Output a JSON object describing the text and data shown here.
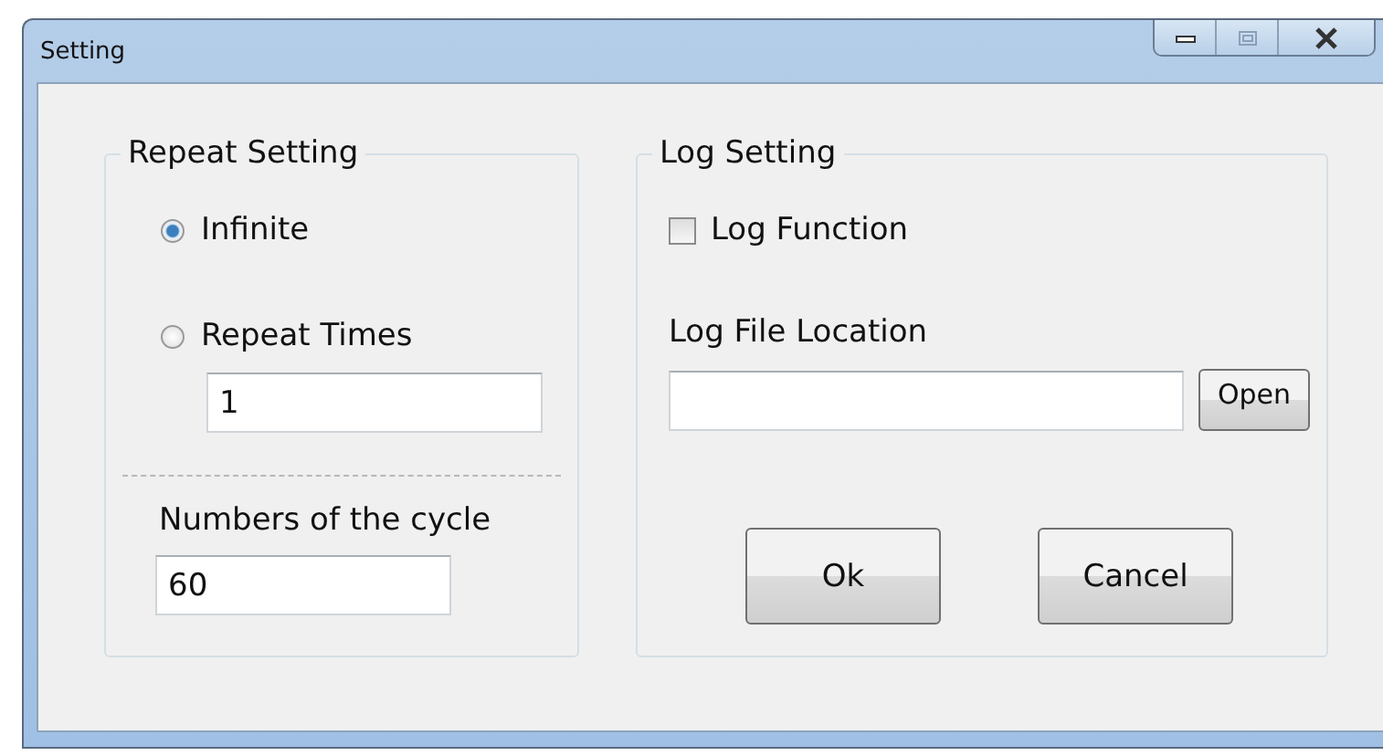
{
  "window": {
    "title": "Setting"
  },
  "repeat_setting": {
    "title": "Repeat Setting",
    "options": [
      {
        "label": "Infinite",
        "selected": true
      },
      {
        "label": "Repeat Times",
        "selected": false
      }
    ],
    "repeat_times": {
      "value": "1"
    },
    "cycle_label": "Numbers of the cycle",
    "cycle": {
      "value": "60"
    }
  },
  "log_setting": {
    "title": "Log Setting",
    "log_function": {
      "label": "Log Function",
      "checked": false
    },
    "location_label": "Log File Location",
    "open_button": "Open"
  },
  "buttons": [
    "Ok",
    "Cancel"
  ]
}
